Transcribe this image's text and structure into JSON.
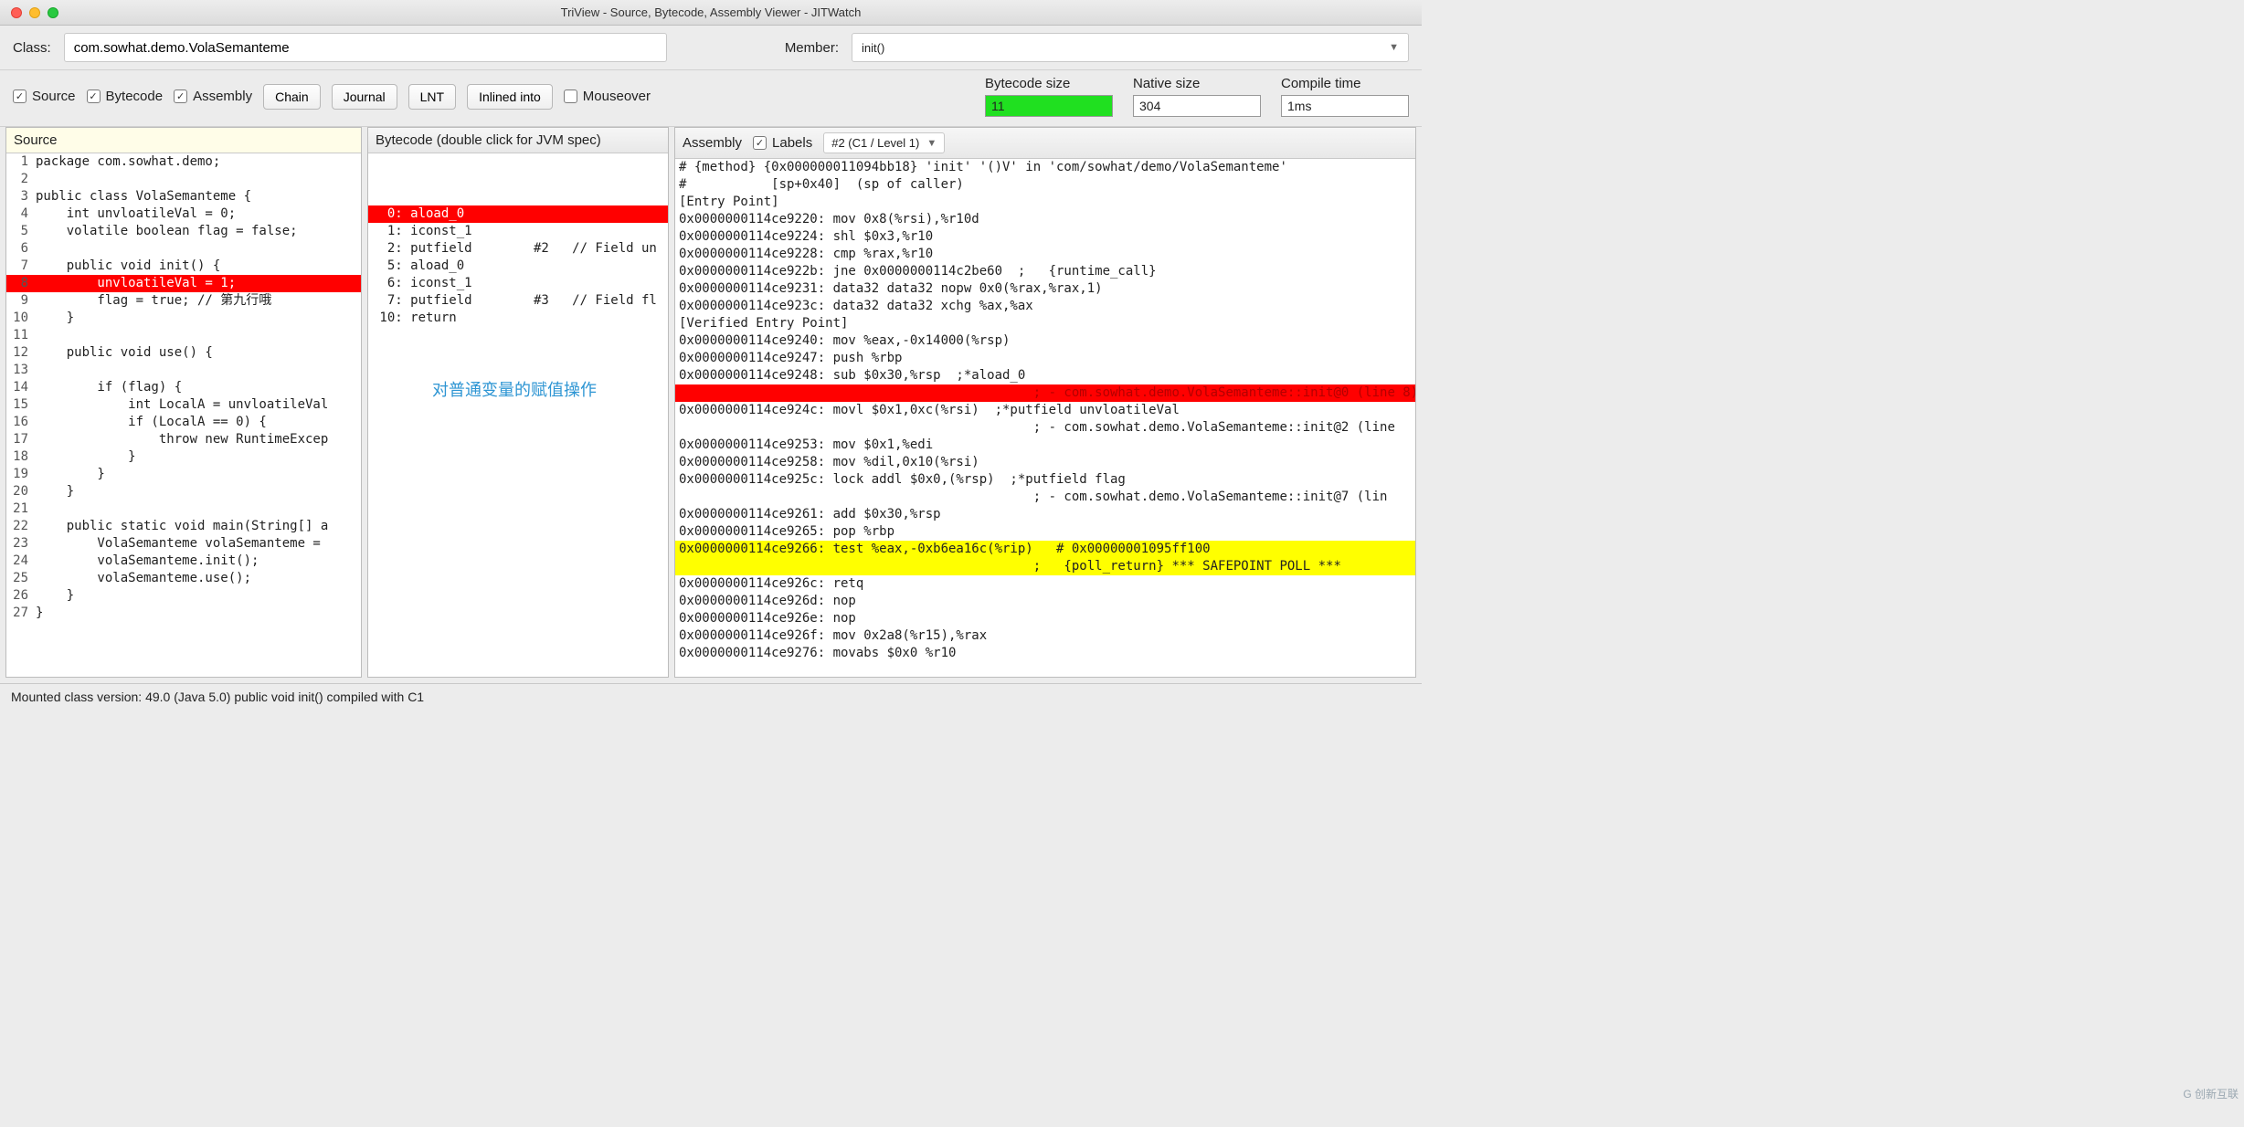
{
  "window_title": "TriView - Source, Bytecode, Assembly Viewer - JITWatch",
  "class_label": "Class:",
  "class_value": "com.sowhat.demo.VolaSemanteme",
  "member_label": "Member:",
  "member_value": "init()",
  "checks": {
    "source": "Source",
    "bytecode": "Bytecode",
    "assembly": "Assembly",
    "mouseover": "Mouseover"
  },
  "buttons": {
    "chain": "Chain",
    "journal": "Journal",
    "lnt": "LNT",
    "inlined": "Inlined into"
  },
  "stats": {
    "bc_label": "Bytecode size",
    "bc_val": "11",
    "native_label": "Native size",
    "native_val": "304",
    "ct_label": "Compile time",
    "ct_val": "1ms"
  },
  "source_head": "Source",
  "bytecode_head": "Bytecode (double click for JVM spec)",
  "assembly_head": "Assembly",
  "labels_cb": "Labels",
  "asm_level": "#2  (C1 / Level 1)",
  "annotation": "对普通变量的赋值操作",
  "status": "Mounted class version: 49.0 (Java 5.0) public void init() compiled with C1",
  "watermark": "G 创新互联",
  "source_lines": [
    {
      "n": "1",
      "t": "package com.sowhat.demo;",
      "hl": ""
    },
    {
      "n": "2",
      "t": "",
      "hl": ""
    },
    {
      "n": "3",
      "t": "public class VolaSemanteme {",
      "hl": ""
    },
    {
      "n": "4",
      "t": "    int unvloatileVal = 0;",
      "hl": ""
    },
    {
      "n": "5",
      "t": "    volatile boolean flag = false;",
      "hl": ""
    },
    {
      "n": "6",
      "t": "",
      "hl": ""
    },
    {
      "n": "7",
      "t": "    public void init() {",
      "hl": ""
    },
    {
      "n": "8",
      "t": "        unvloatileVal = 1;",
      "hl": "red"
    },
    {
      "n": "9",
      "t": "        flag = true; // 第九行哦",
      "hl": ""
    },
    {
      "n": "10",
      "t": "    }",
      "hl": ""
    },
    {
      "n": "11",
      "t": "",
      "hl": ""
    },
    {
      "n": "12",
      "t": "    public void use() {",
      "hl": ""
    },
    {
      "n": "13",
      "t": "",
      "hl": ""
    },
    {
      "n": "14",
      "t": "        if (flag) {",
      "hl": ""
    },
    {
      "n": "15",
      "t": "            int LocalA = unvloatileVal",
      "hl": ""
    },
    {
      "n": "16",
      "t": "            if (LocalA == 0) {",
      "hl": ""
    },
    {
      "n": "17",
      "t": "                throw new RuntimeExcep",
      "hl": ""
    },
    {
      "n": "18",
      "t": "            }",
      "hl": ""
    },
    {
      "n": "19",
      "t": "        }",
      "hl": ""
    },
    {
      "n": "20",
      "t": "    }",
      "hl": ""
    },
    {
      "n": "21",
      "t": "",
      "hl": ""
    },
    {
      "n": "22",
      "t": "    public static void main(String[] a",
      "hl": ""
    },
    {
      "n": "23",
      "t": "        VolaSemanteme volaSemanteme =",
      "hl": ""
    },
    {
      "n": "24",
      "t": "        volaSemanteme.init();",
      "hl": ""
    },
    {
      "n": "25",
      "t": "        volaSemanteme.use();",
      "hl": ""
    },
    {
      "n": "26",
      "t": "    }",
      "hl": ""
    },
    {
      "n": "27",
      "t": "}",
      "hl": ""
    }
  ],
  "bytecode_lines": [
    {
      "n": "0:",
      "t": "aload_0",
      "hl": "red"
    },
    {
      "n": "1:",
      "t": "iconst_1",
      "hl": ""
    },
    {
      "n": "2:",
      "t": "putfield        #2   // Field un",
      "hl": ""
    },
    {
      "n": "5:",
      "t": "aload_0",
      "hl": ""
    },
    {
      "n": "6:",
      "t": "iconst_1",
      "hl": ""
    },
    {
      "n": "7:",
      "t": "putfield        #3   // Field fl",
      "hl": ""
    },
    {
      "n": "10:",
      "t": "return",
      "hl": ""
    }
  ],
  "asm_lines": [
    {
      "t": "# {method} {0x000000011094bb18} 'init' '()V' in 'com/sowhat/demo/VolaSemanteme'",
      "hl": ""
    },
    {
      "t": "#           [sp+0x40]  (sp of caller)",
      "hl": ""
    },
    {
      "t": "[Entry Point]",
      "hl": ""
    },
    {
      "t": "0x0000000114ce9220: mov 0x8(%rsi),%r10d",
      "hl": ""
    },
    {
      "t": "0x0000000114ce9224: shl $0x3,%r10",
      "hl": ""
    },
    {
      "t": "0x0000000114ce9228: cmp %rax,%r10",
      "hl": ""
    },
    {
      "t": "0x0000000114ce922b: jne 0x0000000114c2be60  ;   {runtime_call}",
      "hl": ""
    },
    {
      "t": "0x0000000114ce9231: data32 data32 nopw 0x0(%rax,%rax,1)",
      "hl": ""
    },
    {
      "t": "0x0000000114ce923c: data32 data32 xchg %ax,%ax",
      "hl": ""
    },
    {
      "t": "[Verified Entry Point]",
      "hl": ""
    },
    {
      "t": "0x0000000114ce9240: mov %eax,-0x14000(%rsp)",
      "hl": ""
    },
    {
      "t": "0x0000000114ce9247: push %rbp",
      "hl": ""
    },
    {
      "t": "0x0000000114ce9248: sub $0x30,%rsp  ;*aload_0",
      "hl": ""
    },
    {
      "t": "                                              ; - com.sowhat.demo.VolaSemanteme::init@0 (line 8)",
      "hl": "redb"
    },
    {
      "t": "0x0000000114ce924c: movl $0x1,0xc(%rsi)  ;*putfield unvloatileVal",
      "hl": ""
    },
    {
      "t": "                                              ; - com.sowhat.demo.VolaSemanteme::init@2 (line",
      "hl": ""
    },
    {
      "t": "0x0000000114ce9253: mov $0x1,%edi",
      "hl": ""
    },
    {
      "t": "0x0000000114ce9258: mov %dil,0x10(%rsi)",
      "hl": ""
    },
    {
      "t": "0x0000000114ce925c: lock addl $0x0,(%rsp)  ;*putfield flag",
      "hl": ""
    },
    {
      "t": "                                              ; - com.sowhat.demo.VolaSemanteme::init@7 (lin",
      "hl": ""
    },
    {
      "t": "0x0000000114ce9261: add $0x30,%rsp",
      "hl": ""
    },
    {
      "t": "0x0000000114ce9265: pop %rbp",
      "hl": ""
    },
    {
      "t": "0x0000000114ce9266: test %eax,-0xb6ea16c(%rip)   # 0x00000001095ff100",
      "hl": "yellow"
    },
    {
      "t": "                                              ;   {poll_return} *** SAFEPOINT POLL ***",
      "hl": "yellow"
    },
    {
      "t": "0x0000000114ce926c: retq",
      "hl": ""
    },
    {
      "t": "0x0000000114ce926d: nop",
      "hl": ""
    },
    {
      "t": "0x0000000114ce926e: nop",
      "hl": ""
    },
    {
      "t": "0x0000000114ce926f: mov 0x2a8(%r15),%rax",
      "hl": ""
    },
    {
      "t": "0x0000000114ce9276: movabs $0x0 %r10",
      "hl": ""
    }
  ]
}
